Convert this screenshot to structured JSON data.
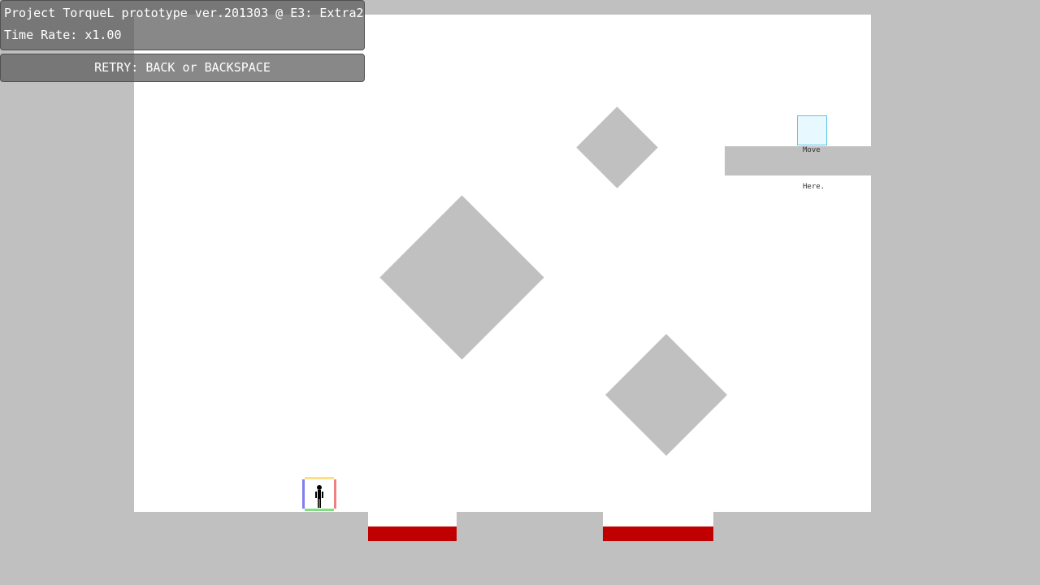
{
  "hud": {
    "title": "Project TorqueL prototype ver.201303 @ E3: Extra2",
    "time_rate": "Time Rate: x1.00",
    "retry_hint": "RETRY: BACK or BACKSPACE"
  },
  "goal": {
    "line1": "Move",
    "line2": "Here."
  },
  "colors": {
    "background": "#c0c0c0",
    "play_area": "#ffffff",
    "hazard": "#c00000",
    "goal_border": "#5ac8e6",
    "player_top": "#ffe080",
    "player_bottom": "#80e080",
    "player_left": "#8080f0",
    "player_right": "#f08080"
  },
  "icons": {
    "player": "stickman-icon"
  }
}
